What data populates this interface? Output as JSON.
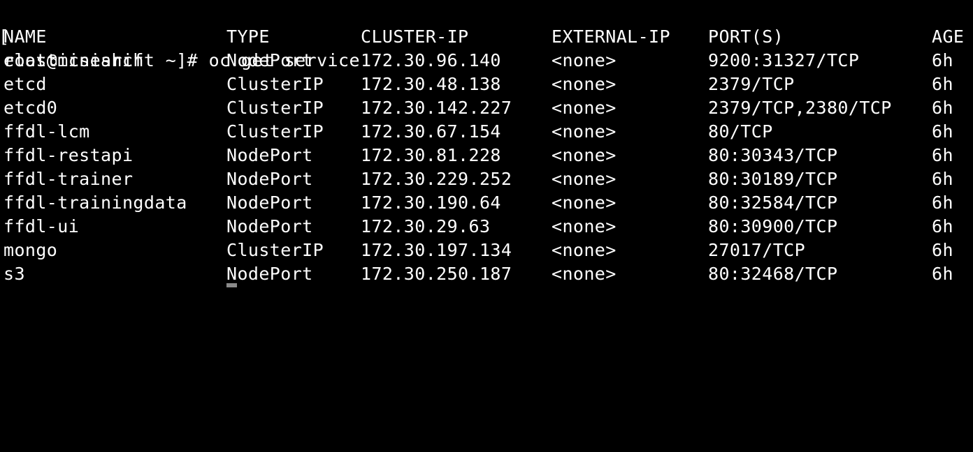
{
  "prompt": {
    "bracket": "[",
    "text": "root@minishift ~]# oc get service"
  },
  "table": {
    "headers": {
      "name": "NAME",
      "type": "TYPE",
      "cluster_ip": "CLUSTER-IP",
      "external_ip": "EXTERNAL-IP",
      "ports": "PORT(S)",
      "age": "AGE"
    },
    "rows": [
      {
        "name": "elasticsearch",
        "type": "NodePort",
        "cluster_ip": "172.30.96.140",
        "external_ip": "<none>",
        "ports": "9200:31327/TCP",
        "age": "6h"
      },
      {
        "name": "etcd",
        "type": "ClusterIP",
        "cluster_ip": "172.30.48.138",
        "external_ip": "<none>",
        "ports": "2379/TCP",
        "age": "6h"
      },
      {
        "name": "etcd0",
        "type": "ClusterIP",
        "cluster_ip": "172.30.142.227",
        "external_ip": "<none>",
        "ports": "2379/TCP,2380/TCP",
        "age": "6h"
      },
      {
        "name": "ffdl-lcm",
        "type": "ClusterIP",
        "cluster_ip": "172.30.67.154",
        "external_ip": "<none>",
        "ports": "80/TCP",
        "age": "6h"
      },
      {
        "name": "ffdl-restapi",
        "type": "NodePort",
        "cluster_ip": "172.30.81.228",
        "external_ip": "<none>",
        "ports": "80:30343/TCP",
        "age": "6h"
      },
      {
        "name": "ffdl-trainer",
        "type": "NodePort",
        "cluster_ip": "172.30.229.252",
        "external_ip": "<none>",
        "ports": "80:30189/TCP",
        "age": "6h"
      },
      {
        "name": "ffdl-trainingdata",
        "type": "NodePort",
        "cluster_ip": "172.30.190.64",
        "external_ip": "<none>",
        "ports": "80:32584/TCP",
        "age": "6h"
      },
      {
        "name": "ffdl-ui",
        "type": "NodePort",
        "cluster_ip": "172.30.29.63",
        "external_ip": "<none>",
        "ports": "80:30900/TCP",
        "age": "6h"
      },
      {
        "name": "mongo",
        "type": "ClusterIP",
        "cluster_ip": "172.30.197.134",
        "external_ip": "<none>",
        "ports": "27017/TCP",
        "age": "6h"
      },
      {
        "name": "s3",
        "type": "NodePort",
        "cluster_ip": "172.30.250.187",
        "external_ip": "<none>",
        "ports": "80:32468/TCP",
        "age": "6h"
      }
    ]
  },
  "colors": {
    "background": "#000000",
    "text": "#ffffff",
    "cursor": "#8a8a8a"
  }
}
